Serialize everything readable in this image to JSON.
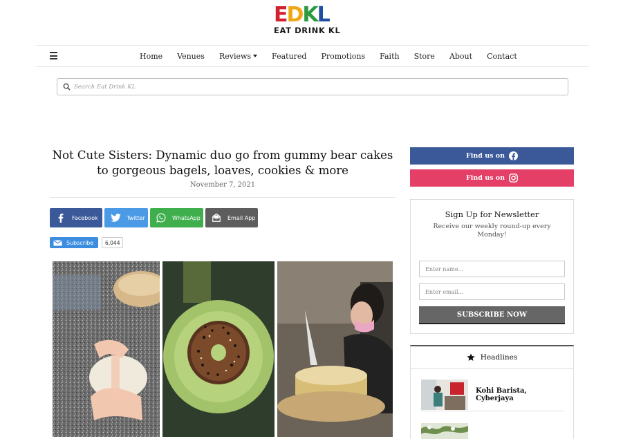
{
  "logo": {
    "letters": [
      {
        "char": "E",
        "color": "#d1222f"
      },
      {
        "char": "D",
        "color": "#f0a714"
      },
      {
        "char": "K",
        "color": "#2c9a3e"
      },
      {
        "char": "L",
        "color": "#1f4ea3"
      }
    ],
    "tagline": "EAT DRINK KL"
  },
  "nav": {
    "items": [
      {
        "label": "Home"
      },
      {
        "label": "Venues"
      },
      {
        "label": "Reviews",
        "dropdown": true
      },
      {
        "label": "Featured"
      },
      {
        "label": "Promotions"
      },
      {
        "label": "Faith"
      },
      {
        "label": "Store"
      },
      {
        "label": "About"
      },
      {
        "label": "Contact"
      }
    ]
  },
  "search": {
    "placeholder": "Search Eat Drink KL",
    "value": ""
  },
  "article": {
    "title": "Not Cute Sisters: Dynamic duo go from gummy bear cakes to gorgeous bagels, loaves, cookies & more",
    "date": "November 7, 2021"
  },
  "share": {
    "facebook": "Facebook",
    "twitter": "Twitter",
    "whatsapp": "WhatsApp",
    "email": "Email App"
  },
  "youtube": {
    "label": "Subscribe",
    "count": "6,044"
  },
  "sidebar": {
    "social": {
      "facebook_label": "Find us on",
      "instagram_label": "Find us on"
    },
    "newsletter": {
      "title": "Sign Up for Newsletter",
      "subtitle": "Receive our weekly round-up every Monday!",
      "name_placeholder": "Enter name...",
      "email_placeholder": "Enter email...",
      "submit_label": "SUBSCRIBE NOW"
    },
    "headlines": {
      "title": "Headlines",
      "items": [
        {
          "title": "Kohi Barista, Cyberjaya"
        }
      ]
    }
  },
  "colors": {
    "facebook": "#3b5998",
    "instagram": "#e33f67",
    "twitter": "#4a9ae6",
    "whatsapp": "#3fae4d",
    "email": "#5d5d5d"
  }
}
